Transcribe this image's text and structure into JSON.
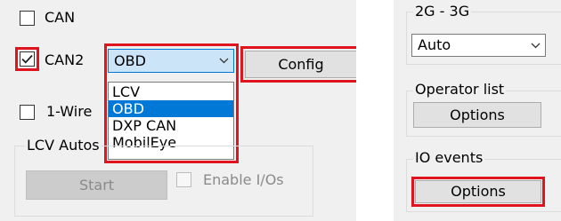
{
  "can_row": {
    "label": "CAN",
    "checked": false
  },
  "can2_row": {
    "label": "CAN2",
    "checked": true,
    "select_value": "OBD",
    "config_button": "Config",
    "dropdown_options": [
      "LCV",
      "OBD",
      "DXP CAN",
      "MobilEye"
    ],
    "selected_option": "OBD"
  },
  "onewire_row": {
    "label": "1-Wire",
    "checked": false
  },
  "lcv_group": {
    "title": "LCV Autos",
    "start_button": "Start",
    "enable_ios_label": "Enable I/Os",
    "enable_ios_checked": false
  },
  "network_group": {
    "title": "2G - 3G",
    "select_value": "Auto"
  },
  "operator_group": {
    "title": "Operator list",
    "button": "Options"
  },
  "io_group": {
    "title": "IO events",
    "button": "Options"
  },
  "colors": {
    "highlight_red": "#e0141e",
    "selection_blue": "#0078d7"
  }
}
